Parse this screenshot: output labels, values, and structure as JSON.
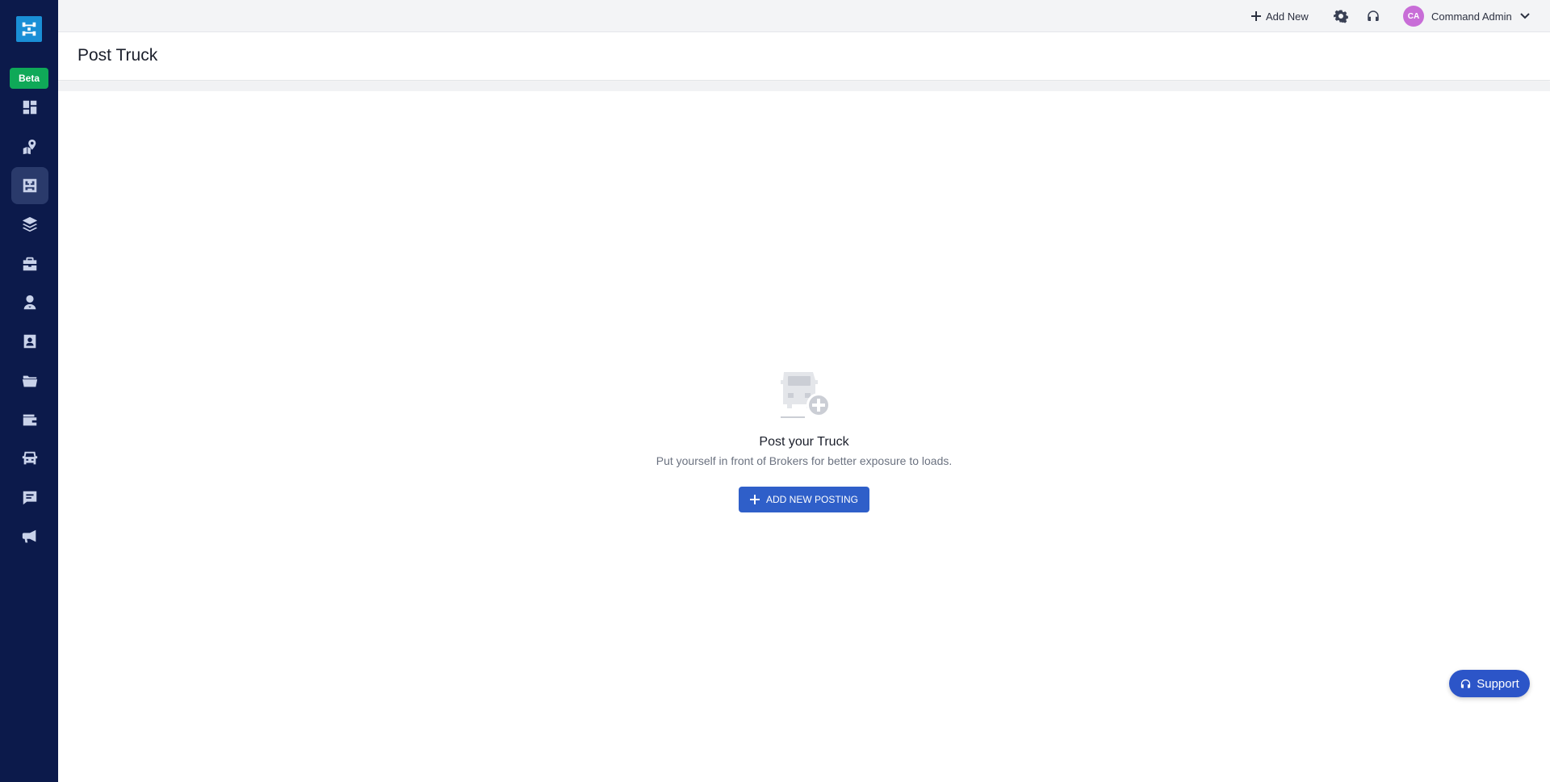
{
  "header": {
    "add_new_label": "Add New",
    "user_initials": "CA",
    "user_name": "Command Admin"
  },
  "sidebar": {
    "beta_label": "Beta",
    "items": [
      {
        "icon": "dashboard-icon"
      },
      {
        "icon": "map-pin-icon"
      },
      {
        "icon": "post-truck-icon",
        "active": true
      },
      {
        "icon": "layers-icon"
      },
      {
        "icon": "briefcase-icon"
      },
      {
        "icon": "driver-icon"
      },
      {
        "icon": "contact-card-icon"
      },
      {
        "icon": "folder-icon"
      },
      {
        "icon": "wallet-icon"
      },
      {
        "icon": "truck-icon"
      },
      {
        "icon": "message-icon"
      },
      {
        "icon": "megaphone-icon"
      }
    ]
  },
  "page": {
    "title": "Post Truck"
  },
  "empty_state": {
    "title": "Post your Truck",
    "subtitle": "Put yourself in front of Brokers for better exposure to loads.",
    "button_label": "ADD NEW POSTING"
  },
  "support": {
    "label": "Support"
  },
  "colors": {
    "sidebar_bg": "#0c1a4b",
    "accent": "#2f5fc9",
    "beta_badge": "#0fa958",
    "avatar": "#c86dd7"
  }
}
